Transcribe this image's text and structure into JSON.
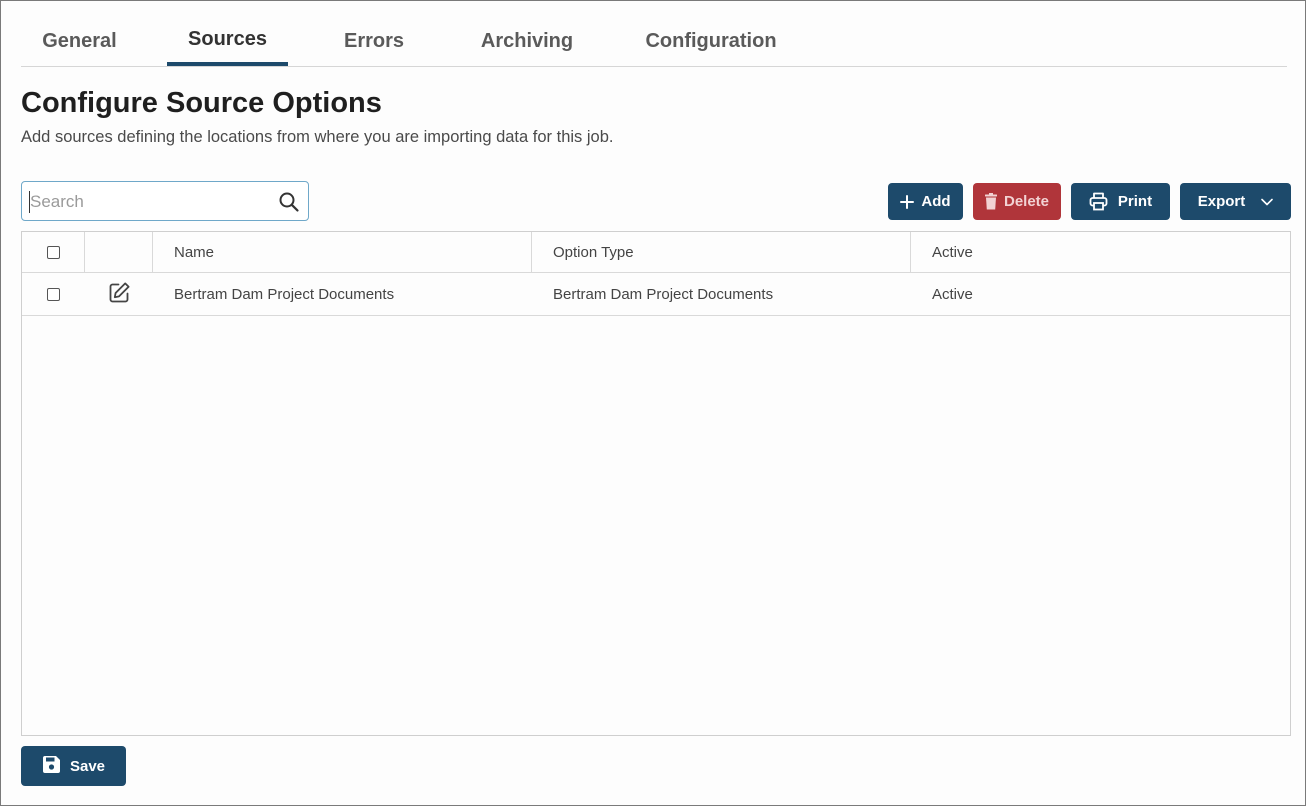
{
  "tabs": [
    {
      "label": "General"
    },
    {
      "label": "Sources"
    },
    {
      "label": "Errors"
    },
    {
      "label": "Archiving"
    },
    {
      "label": "Configuration"
    }
  ],
  "active_tab": "Sources",
  "header": {
    "title": "Configure Source Options",
    "subtitle": "Add sources defining the locations from where you are importing data for this job."
  },
  "search": {
    "placeholder": "Search",
    "value": "",
    "icon": "search-icon"
  },
  "toolbar": {
    "add_label": "Add",
    "delete_label": "Delete",
    "print_label": "Print",
    "export_label": "Export"
  },
  "grid": {
    "columns": [
      "Name",
      "Option Type",
      "Active"
    ],
    "rows": [
      {
        "name": "Bertram Dam Project Documents",
        "option_type": "Bertram Dam Project Documents",
        "active": "Active"
      }
    ]
  },
  "footer": {
    "save_label": "Save"
  },
  "colors": {
    "primary": "#1d4a6b",
    "danger": "#b0353a",
    "search_border": "#6fa8c9"
  }
}
